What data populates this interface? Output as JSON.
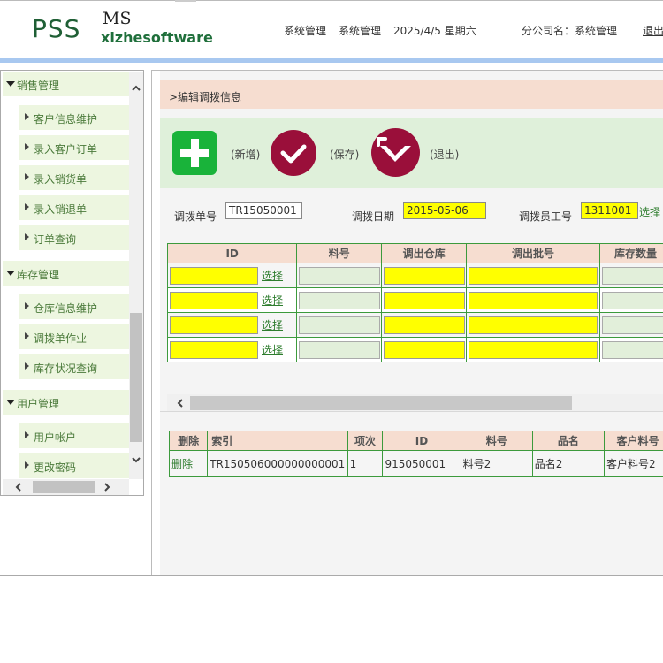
{
  "header": {
    "logo_main": "PSS",
    "logo_ms": "MS",
    "logo_sub": "xizhesoftware",
    "sys_menu_1": "系统管理",
    "sys_menu_2": "系统管理",
    "date": "2025/4/5 星期六",
    "company": "分公司名：系统管理",
    "logout": "退出"
  },
  "sidebar": {
    "groups": [
      {
        "label": "销售管理",
        "items": [
          "客户信息维护",
          "录入客户订单",
          "录入销货单",
          "录入销退单",
          "订单查询"
        ]
      },
      {
        "label": "库存管理",
        "items": [
          "仓库信息维护",
          "调拨单作业",
          "库存状况查询"
        ]
      },
      {
        "label": "用户管理",
        "items": [
          "用户帐户",
          "更改密码"
        ]
      }
    ]
  },
  "page": {
    "title": ">编辑调拨信息"
  },
  "toolbar": {
    "new_label": "(新增)",
    "save_label": "(保存)",
    "exit_label": "(退出)"
  },
  "form": {
    "order_no_label": "调拨单号",
    "order_no_value": "TR15050001",
    "date_label": "调拨日期",
    "date_value": "2015-05-06",
    "employee_label": "调拨员工号",
    "employee_value": "1311001",
    "select_link": "选择"
  },
  "upper_grid": {
    "columns": [
      "ID",
      "料号",
      "调出仓库",
      "调出批号",
      "库存数量"
    ],
    "select_link": "选择",
    "row_count": 4
  },
  "lower_grid": {
    "columns": [
      "删除",
      "索引",
      "项次",
      "ID",
      "料号",
      "品名",
      "客户料号"
    ],
    "rows": [
      {
        "delete": "删除",
        "index": "TR150506000000000001",
        "item": "1",
        "id": "915050001",
        "part": "料号2",
        "name": "品名2",
        "cust": "客户料号2"
      }
    ]
  },
  "colors": {
    "accent_green": "#1f6f3b",
    "header_blue": "#a8c8f0",
    "required_yellow": "#ffff00",
    "grid_border": "#3c9a3c",
    "button_maroon": "#9a0f3a",
    "button_green": "#19b33a"
  }
}
